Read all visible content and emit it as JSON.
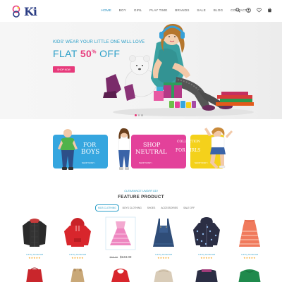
{
  "brand": {
    "name": "Ki"
  },
  "nav": {
    "items": [
      "HOME",
      "BOY",
      "GIRL",
      "PLAY TIME",
      "BRANDS",
      "SALE",
      "BLOG",
      "CONTACT"
    ],
    "active": "HOME"
  },
  "header_icons": [
    "search-icon",
    "user-icon",
    "heart-icon",
    "cart-icon"
  ],
  "hero": {
    "subtitle": "KIDS' WEAR YOUR LITTLE ONE WILL LOVE",
    "title_pre": "FLAT ",
    "title_pct": "50",
    "title_pct_sup": "%",
    "title_post": " OFF",
    "button": "SHOP NOW",
    "slides": 3,
    "active_slide": 1
  },
  "categories": [
    {
      "line1": "FOR",
      "line2": "BOYS",
      "link": "SHOP NOW >",
      "color": "#35a6df"
    },
    {
      "line1": "SHOP",
      "line2": "NEUTRAL",
      "link": "SHOP NOW >",
      "color": "#e3419a"
    },
    {
      "line1": "COLLECTION",
      "line2": "FOR GIRLS",
      "link": "SHOP NOW >",
      "color": "#f4d11b"
    }
  ],
  "feature": {
    "subtitle": "CLEARANCE UNDER $10",
    "title": "FEATURE PRODUCT",
    "tabs": [
      "KIDS CLOTHING",
      "BOYS CLOTHING",
      "SHOES",
      "ACCESSORIES",
      "SALE OFF"
    ],
    "active_tab": "KIDS CLOTHING"
  },
  "products": [
    {
      "name": "Loft by Gunkerwill",
      "stars": "★★★★★",
      "kind": "jacket-black"
    },
    {
      "name": "Loft by Gunkerwill",
      "stars": "★★★★★",
      "kind": "hoodie-red"
    },
    {
      "name": "",
      "old_price": "$58.00",
      "price": "$134.00",
      "kind": "dress-pink"
    },
    {
      "name": "Loft by Gunkerwill",
      "stars": "★★★★★",
      "kind": "overall-denim"
    },
    {
      "name": "Loft by Gunkerwill",
      "stars": "★★★★★",
      "kind": "jacket-print"
    },
    {
      "name": "Loft by Gunkerwill",
      "stars": "★★★★★",
      "kind": "dress-coral"
    }
  ],
  "colors": {
    "accent": "#2c9fc8",
    "pink": "#e73a7b",
    "blue_banner": "#35a6df",
    "pink_banner": "#e3419a",
    "yellow_banner": "#f4d11b",
    "star": "#f4a623"
  }
}
